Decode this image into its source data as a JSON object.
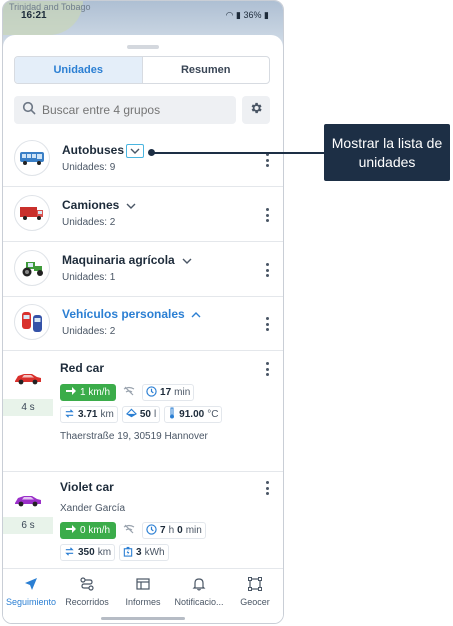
{
  "status_bar": {
    "time": "16:21",
    "map_label": "Trinidad and Tobago",
    "battery": "36%"
  },
  "tabs": [
    {
      "label": "Unidades",
      "active": true
    },
    {
      "label": "Resumen",
      "active": false
    }
  ],
  "search": {
    "placeholder": "Buscar entre 4 grupos",
    "value": ""
  },
  "groups": [
    {
      "name": "Autobuses",
      "count": "Unidades: 9",
      "icon": "bus-icon",
      "expanded": false
    },
    {
      "name": "Camiones",
      "count": "Unidades: 2",
      "icon": "truck-icon",
      "expanded": false
    },
    {
      "name": "Maquinaria agrícola",
      "count": "Unidades: 1",
      "icon": "tractor-icon",
      "expanded": false
    },
    {
      "name": "Vehículos personales",
      "count": "Unidades: 2",
      "icon": "cars-icon",
      "expanded": true
    }
  ],
  "units": [
    {
      "name": "Red car",
      "age": "4 s",
      "icon": "red-car-icon",
      "speed": "1 km/h",
      "time_value": "17",
      "time_unit": "min",
      "mileage_value": "3.71",
      "mileage_unit": "km",
      "fuel_value": "50",
      "fuel_unit": "l",
      "temp_value": "91.00",
      "temp_unit": "°C",
      "address": "Thaerstraße 19, 30519 Hannover"
    },
    {
      "name": "Violet car",
      "age": "6 s",
      "icon": "violet-car-icon",
      "driver": "Xander García",
      "speed": "0 km/h",
      "time_hours": "7",
      "time_h_unit": "h",
      "time_minutes": "0",
      "time_unit": "min",
      "mileage_value": "350",
      "mileage_unit": "km",
      "energy_value": "3",
      "energy_unit": "kWh"
    }
  ],
  "bottom_nav": [
    {
      "label": "Seguimiento",
      "icon": "navigation-arrow-icon",
      "active": true
    },
    {
      "label": "Recorridos",
      "icon": "route-icon",
      "active": false
    },
    {
      "label": "Informes",
      "icon": "report-icon",
      "active": false
    },
    {
      "label": "Notificacio...",
      "icon": "bell-icon",
      "active": false
    },
    {
      "label": "Geocer",
      "icon": "geofence-icon",
      "active": false
    }
  ],
  "callout": {
    "text": "Mostrar la lista de unidades"
  },
  "colors": {
    "accent": "#2b7fd3",
    "speed_green": "#3bac4a",
    "callout_bg": "#1d2f45",
    "highlight": "#49b5e0"
  }
}
